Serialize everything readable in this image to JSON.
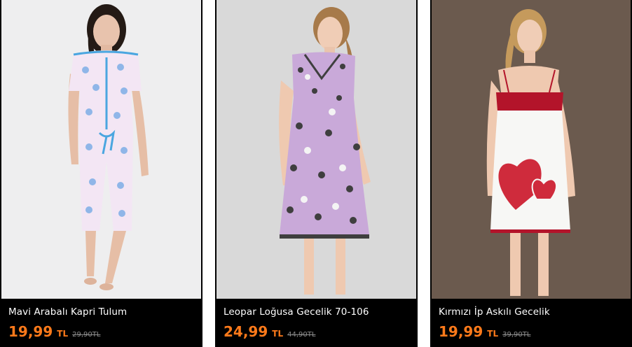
{
  "products": [
    {
      "name": "Mavi Arabalı Kapri Tulum",
      "price": "19,99",
      "currency": "TL",
      "old_price": "29,90TL",
      "image_alt": "light pink short-sleeve capri jumpsuit with blue car print",
      "colors": {
        "background": "#eeeeef",
        "garment": "#f3e6f4",
        "accent": "#4aa6e0"
      }
    },
    {
      "name": "Leopar Loğusa Gecelik 70-106",
      "price": "24,99",
      "currency": "TL",
      "old_price": "44,90TL",
      "image_alt": "pink and grey leopard print short-sleeve nightgown",
      "colors": {
        "background": "#d9d9d9",
        "garment": "#c9a9d9",
        "accent": "#3f3f3f"
      }
    },
    {
      "name": "Kırmızı İp Askılı Gecelik",
      "price": "19,99",
      "currency": "TL",
      "old_price": "39,90TL",
      "image_alt": "white strappy nightgown with red top and gingham heart appliqué",
      "colors": {
        "background": "#6b5a4e",
        "garment": "#f7f7f5",
        "accent": "#b3142a"
      }
    }
  ],
  "theme": {
    "price_color": "#ff7a1a",
    "old_price_color": "#8c8c8c",
    "card_background": "#000000"
  }
}
